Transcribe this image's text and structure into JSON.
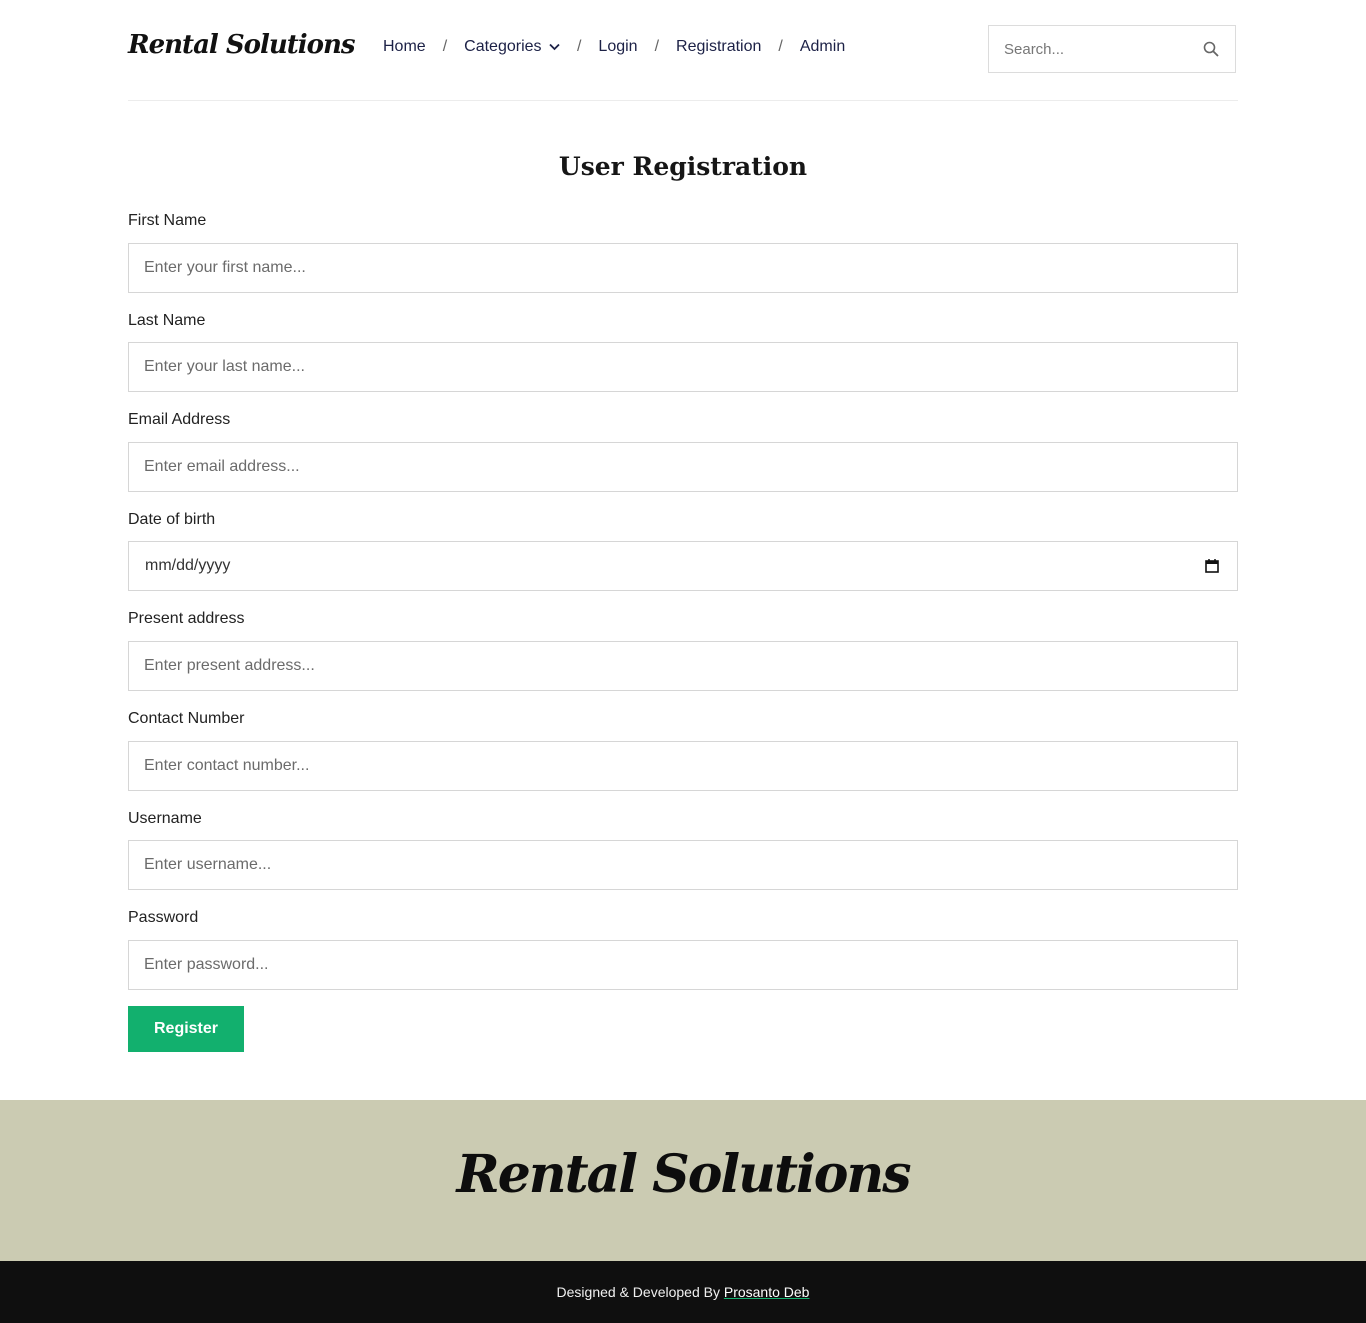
{
  "header": {
    "logo": "Rental Solutions",
    "nav": {
      "home": "Home",
      "categories": "Categories",
      "login": "Login",
      "registration": "Registration",
      "admin": "Admin",
      "separator": "/"
    },
    "search_placeholder": "Search...",
    "search_icon": "search-icon"
  },
  "form": {
    "title": "User Registration",
    "fields": {
      "first_name": {
        "label": "First Name",
        "placeholder": "Enter your first name..."
      },
      "last_name": {
        "label": "Last Name",
        "placeholder": "Enter your last name..."
      },
      "email": {
        "label": "Email Address",
        "placeholder": "Enter email address..."
      },
      "dob": {
        "label": "Date of birth",
        "value": "mm/dd/yyyy"
      },
      "address": {
        "label": "Present address",
        "placeholder": "Enter present address..."
      },
      "contact": {
        "label": "Contact Number",
        "placeholder": "Enter contact number..."
      },
      "username": {
        "label": "Username",
        "placeholder": "Enter username..."
      },
      "password": {
        "label": "Password",
        "placeholder": "Enter password..."
      }
    },
    "submit_label": "Register",
    "accent_color": "#12b06e"
  },
  "footer": {
    "logo": "Rental Solutions",
    "credit_prefix": "Designed & Developed By",
    "credit_name": "Prosanto Deb",
    "band_color": "#cbcbb2",
    "bottom_color": "#0f0f0f"
  }
}
